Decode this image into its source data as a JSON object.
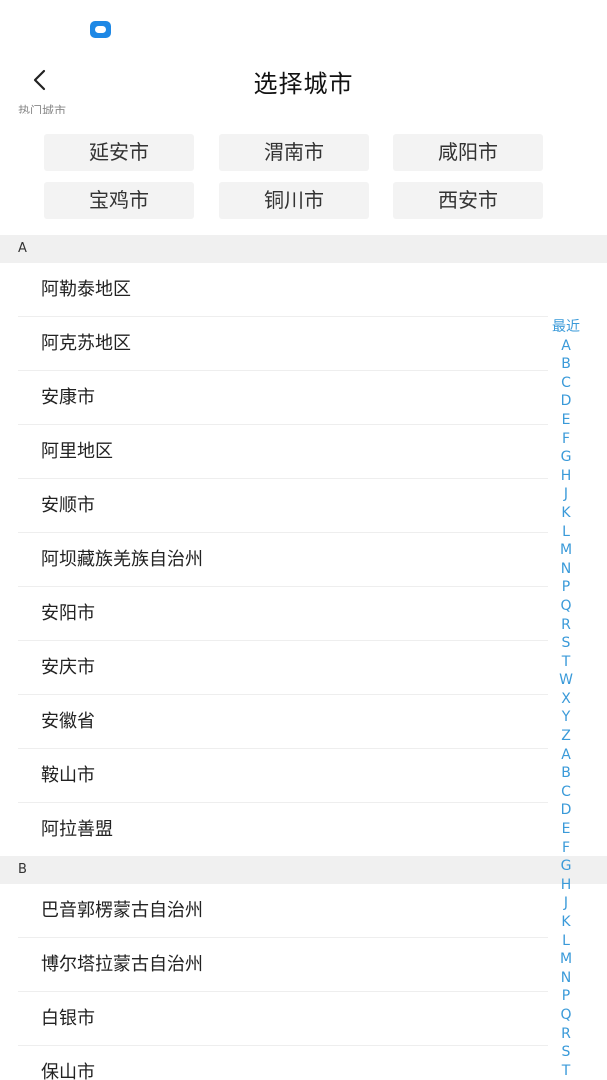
{
  "header": {
    "title": "选择城市"
  },
  "hot_section": {
    "label": "热门城市",
    "cities": [
      "延安市",
      "渭南市",
      "咸阳市",
      "宝鸡市",
      "铜川市",
      "西安市"
    ]
  },
  "sections": [
    {
      "letter": "A",
      "cities": [
        "阿勒泰地区",
        "阿克苏地区",
        "安康市",
        "阿里地区",
        "安顺市",
        "阿坝藏族羌族自治州",
        "安阳市",
        "安庆市",
        "安徽省",
        "鞍山市",
        "阿拉善盟"
      ]
    },
    {
      "letter": "B",
      "cities": [
        "巴音郭楞蒙古自治州",
        "博尔塔拉蒙古自治州",
        "白银市",
        "保山市"
      ]
    }
  ],
  "alpha_index": [
    "最近",
    "A",
    "B",
    "C",
    "D",
    "E",
    "F",
    "G",
    "H",
    "J",
    "K",
    "L",
    "M",
    "N",
    "P",
    "Q",
    "R",
    "S",
    "T",
    "W",
    "X",
    "Y",
    "Z",
    "A",
    "B",
    "C",
    "D",
    "E",
    "F",
    "G",
    "H",
    "J",
    "K",
    "L",
    "M",
    "N",
    "P",
    "Q",
    "R",
    "S",
    "T"
  ],
  "icons": {
    "notification": "chat-bubble-icon",
    "back": "chevron-left-icon"
  },
  "colors": {
    "accent": "#3a9ad9",
    "notification": "#1e88e5",
    "section_bg": "#f0f0f0",
    "chip_bg": "#f3f3f3"
  }
}
